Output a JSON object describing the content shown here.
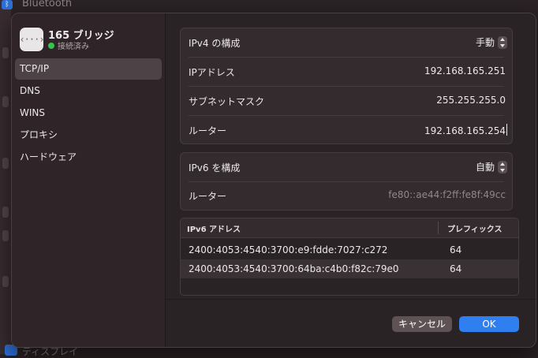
{
  "background": {
    "top_item": "Bluetooth",
    "bottom_item": "ディスプレイ"
  },
  "device": {
    "name": "165 ブリッジ",
    "status": "接続済み",
    "icon": "bridge-icon"
  },
  "sidebar": {
    "items": [
      {
        "label": "TCP/IP",
        "selected": true
      },
      {
        "label": "DNS",
        "selected": false
      },
      {
        "label": "WINS",
        "selected": false
      },
      {
        "label": "プロキシ",
        "selected": false
      },
      {
        "label": "ハードウェア",
        "selected": false
      }
    ]
  },
  "ipv4": {
    "config_label": "IPv4 の構成",
    "config_value": "手動",
    "ip_label": "IPアドレス",
    "ip_value": "192.168.165.251",
    "subnet_label": "サブネットマスク",
    "subnet_value": "255.255.255.0",
    "router_label": "ルーター",
    "router_value": "192.168.165.254"
  },
  "ipv6": {
    "config_label": "IPv6 を構成",
    "config_value": "自動",
    "router_label": "ルーター",
    "router_value": "fe80::ae44:f2ff:fe8f:49cc"
  },
  "ipv6_table": {
    "headers": [
      "IPv6 アドレス",
      "プレフィックス"
    ],
    "rows": [
      {
        "address": "2400:4053:4540:3700:e9:fdde:7027:c272",
        "prefix": "64"
      },
      {
        "address": "2400:4053:4540:3700:64ba:c4b0:f82c:79e0",
        "prefix": "64"
      }
    ]
  },
  "buttons": {
    "cancel": "キャンセル",
    "ok": "OK"
  },
  "colors": {
    "accent": "#2f7ff0",
    "connected": "#35c44a"
  }
}
